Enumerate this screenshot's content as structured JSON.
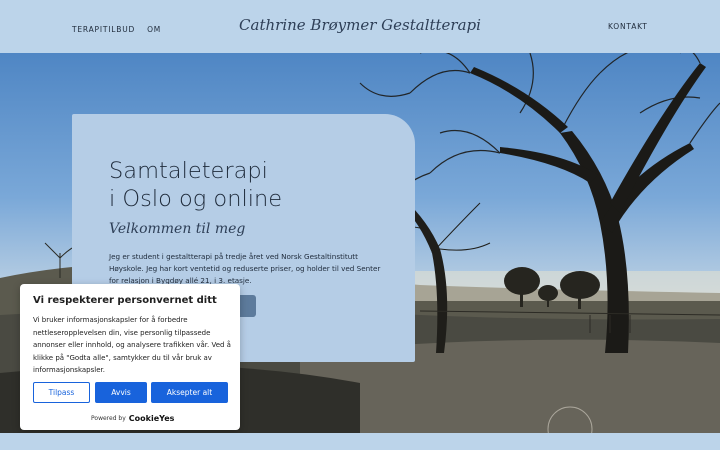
{
  "header": {
    "nav_left": [
      "TERAPITILBUD",
      "OM"
    ],
    "site_title": "Cathrine Brøymer Gestaltterapi",
    "nav_right": "KONTAKT"
  },
  "hero": {
    "title_line1": "Samtaleterapi",
    "title_line2": "i Oslo og online",
    "subtitle": "Velkommen til meg",
    "text": "Jeg er student i gestaltterapi på tredje året ved Norsk Gestaltinstitutt Høyskole. Jeg har kort ventetid og reduserte priser, og holder til ved Senter for relasjon i Bygdøy allé 21, i 3. etasje."
  },
  "cookie": {
    "title": "Vi respekterer personvernet ditt",
    "text": "Vi bruker informasjonskapsler for å forbedre nettleseropplevelsen din, vise personlig tilpassede annonser eller innhold, og analysere trafikken vår. Ved å klikke på \"Godta alle\", samtykker du til vår bruk av informasjonskapsler.",
    "btn_customize": "Tilpass",
    "btn_reject": "Avvis",
    "btn_accept": "Aksepter alt",
    "powered_by": "Powered by",
    "powered_logo": "CookieYes"
  },
  "colors": {
    "header_bg": "#bcd4ea",
    "card_bg": "#b5cde6",
    "cookie_accent": "#1863dc",
    "text_dark": "#1e2a3a"
  }
}
